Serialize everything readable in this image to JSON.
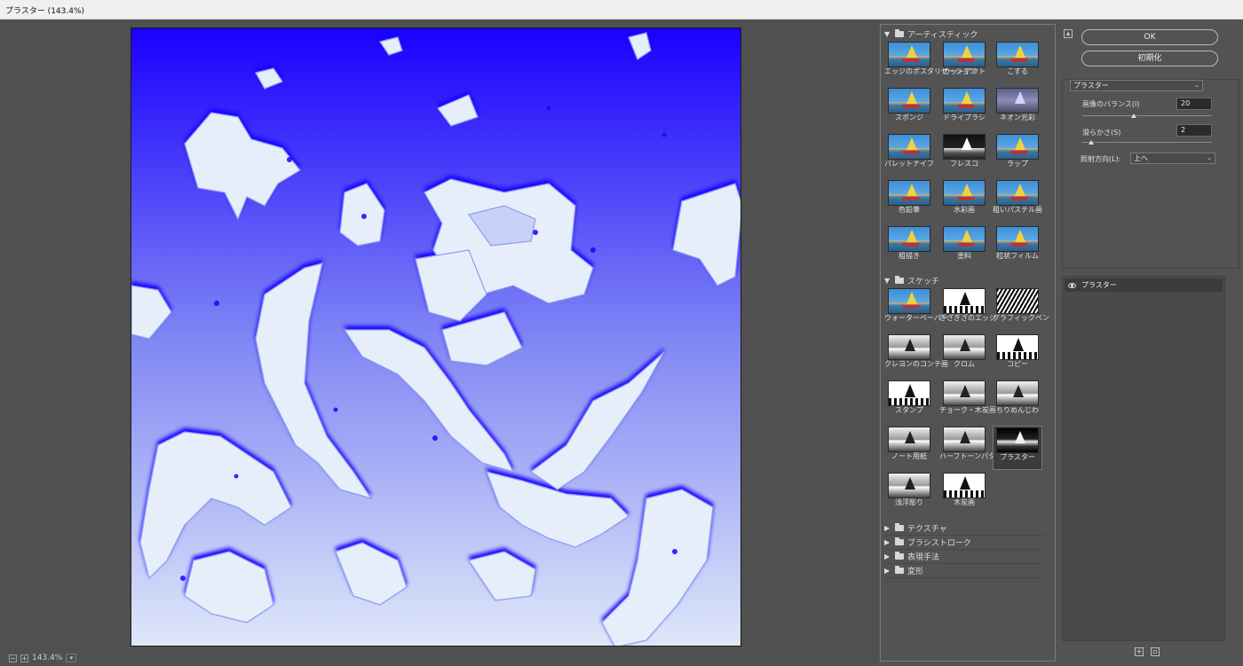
{
  "window": {
    "title": "プラスター (143.4%)"
  },
  "preview": {
    "zoom": "143.4%"
  },
  "gallery": {
    "categories": [
      {
        "name": "アーティスティック",
        "expanded": true,
        "filters": [
          {
            "label": "エッジのポスタリゼーション",
            "style": "color"
          },
          {
            "label": "カットアウト",
            "style": "color"
          },
          {
            "label": "こする",
            "style": "color"
          },
          {
            "label": "スポンジ",
            "style": "color"
          },
          {
            "label": "ドライブラシ",
            "style": "color"
          },
          {
            "label": "ネオン光彩",
            "style": "neon"
          },
          {
            "label": "パレットナイフ",
            "style": "color"
          },
          {
            "label": "フレスコ",
            "style": "dark"
          },
          {
            "label": "ラップ",
            "style": "color"
          },
          {
            "label": "色鉛筆",
            "style": "color"
          },
          {
            "label": "水彩画",
            "style": "color"
          },
          {
            "label": "粗いパステル画",
            "style": "color"
          },
          {
            "label": "粗描き",
            "style": "color"
          },
          {
            "label": "塗料",
            "style": "color"
          },
          {
            "label": "粒状フィルム",
            "style": "color"
          }
        ]
      },
      {
        "name": "スケッチ",
        "expanded": true,
        "filters": [
          {
            "label": "ウォーターペーパー",
            "style": "color"
          },
          {
            "label": "ぎざぎざのエッジ",
            "style": "sketch"
          },
          {
            "label": "グラフィックペン",
            "style": "graphic"
          },
          {
            "label": "クレヨンのコンテ画",
            "style": "gray"
          },
          {
            "label": "クロム",
            "style": "gray"
          },
          {
            "label": "コピー",
            "style": "sketch"
          },
          {
            "label": "スタンプ",
            "style": "sketch"
          },
          {
            "label": "チョーク・木炭画",
            "style": "gray"
          },
          {
            "label": "ちりめんじわ",
            "style": "gray"
          },
          {
            "label": "ノート用紙",
            "style": "gray"
          },
          {
            "label": "ハーフトーンパターン",
            "style": "gray"
          },
          {
            "label": "プラスター",
            "style": "plaster",
            "selected": true
          },
          {
            "label": "浅浮彫り",
            "style": "gray"
          },
          {
            "label": "木炭画",
            "style": "sketch"
          }
        ]
      },
      {
        "name": "テクスチャ",
        "expanded": false
      },
      {
        "name": "ブラシストローク",
        "expanded": false
      },
      {
        "name": "表現手法",
        "expanded": false
      },
      {
        "name": "変形",
        "expanded": false
      }
    ]
  },
  "panel": {
    "ok_label": "OK",
    "reset_label": "初期化",
    "filter_select": "プラスター",
    "params": {
      "balance_label": "画像のバランス(I)",
      "balance_value": "20",
      "balance_level": 0.4,
      "smooth_label": "滑らかさ(S)",
      "smooth_value": "2",
      "smooth_level": 0.07,
      "light_label": "照射方向(L):",
      "light_value": "上へ"
    },
    "layer_name": "プラスター"
  },
  "colors": {
    "accent_blue": "#1a00ff",
    "light_blue": "#dfe8f8",
    "panel": "#535353"
  }
}
